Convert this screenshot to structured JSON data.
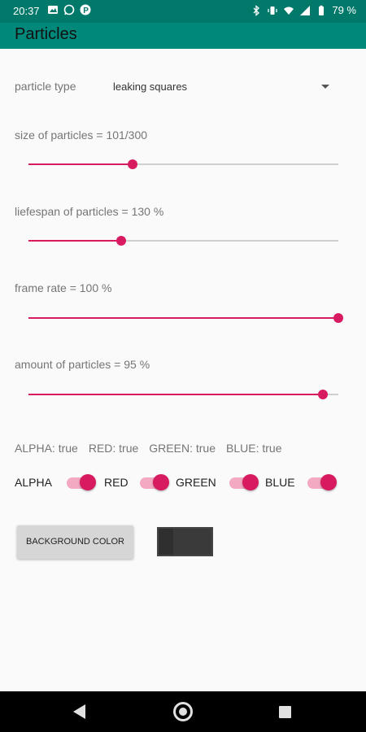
{
  "status_bar": {
    "time": "20:37",
    "battery": "79 %",
    "left_icons": [
      "image-icon",
      "whatsapp-icon",
      "p-icon"
    ],
    "right_icons": [
      "bluetooth-icon",
      "vibrate-icon",
      "wifi-icon",
      "signal-icon",
      "battery-icon"
    ],
    "p_badge": "P"
  },
  "app_bar": {
    "title": "Particles"
  },
  "particle_type": {
    "label": "particle type",
    "selected": "leaking squares"
  },
  "sliders": [
    {
      "label": "size of particles = 101/300",
      "value": 101,
      "max": 300
    },
    {
      "label": "liefespan of particles = 130 %",
      "value": 0.3,
      "max": 1
    },
    {
      "label": "frame rate = 100 %",
      "value": 1.0,
      "max": 1
    },
    {
      "label": "amount of particles = 95 %",
      "value": 0.95,
      "max": 1
    }
  ],
  "channel_state": {
    "alpha": "ALPHA: true",
    "red": "RED: true",
    "green": "GREEN: true",
    "blue": "BLUE: true"
  },
  "switches": [
    {
      "label": "ALPHA",
      "on": true
    },
    {
      "label": "RED",
      "on": true
    },
    {
      "label": "GREEN",
      "on": true
    },
    {
      "label": "BLUE",
      "on": true
    }
  ],
  "background_color_button": "BACKGROUND COLOR",
  "colors": {
    "status_bar": "#00796b",
    "app_bar": "#00897b",
    "accent": "#d81b60",
    "accent_light": "#f4a9c2",
    "swatch": "#2f2f2f"
  },
  "nav_bar": [
    "back-icon",
    "home-icon",
    "recents-icon"
  ]
}
